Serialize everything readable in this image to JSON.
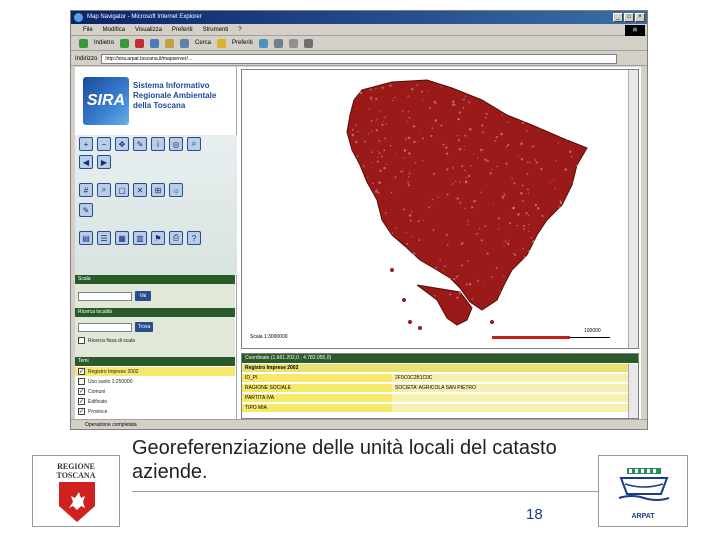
{
  "browser": {
    "title": "Map Navigator - Microsoft Internet Explorer",
    "menu": [
      "File",
      "Modifica",
      "Visualizza",
      "Preferiti",
      "Strumenti",
      "?"
    ],
    "toolbar": {
      "back": "Indietro",
      "search": "Cerca",
      "favorites": "Preferiti"
    },
    "address_label": "Indirizzo",
    "address": "http://sira.arpat.toscana.it/mapserver/...",
    "status": "Operazione completata"
  },
  "sira": {
    "badge": "SIRA",
    "lines": [
      "Sistema Informativo",
      "Regionale Ambientale",
      "della Toscana"
    ]
  },
  "left_panel": {
    "scala_label": "Scala",
    "scala_button": "Vai",
    "ricerca_label": "Ricerca località",
    "ricerca_button": "Trova",
    "scale_checkbox": "Ricerca fissa di scala",
    "temi_label": "Temi",
    "layers": [
      {
        "label": "Registro Imprese 2002",
        "checked": true,
        "highlight": true
      },
      {
        "label": "Uso suolo 1:250000",
        "checked": false,
        "highlight": false
      },
      {
        "label": "Comuni",
        "checked": true,
        "highlight": false
      },
      {
        "label": "Edificato",
        "checked": true,
        "highlight": false
      },
      {
        "label": "Province",
        "checked": true,
        "highlight": false
      }
    ]
  },
  "map": {
    "scale_text": "Scala 1:3000000",
    "scale_bar_label": "100000"
  },
  "info": {
    "header": "Coordinate (1.661.202,0 ; 4.782.055,0)",
    "group": "Registro Imprese 2002",
    "rows": [
      {
        "key": "ID_PI",
        "value": "2F0C0C2B1C0C"
      },
      {
        "key": "RAGIONE SOCIALE",
        "value": "SOCIETA' AGRICOLA SAN PIETRO"
      },
      {
        "key": "PARTITA IVA",
        "value": ""
      },
      {
        "key": "TIPO MIA",
        "value": ""
      }
    ]
  },
  "slide": {
    "caption": "Georeferenziazione delle unità locali del catasto aziende.",
    "page_number": "18",
    "logo_left_lines": [
      "REGIONE",
      "TOSCANA"
    ],
    "logo_right_text": "ARPAT"
  },
  "colors": {
    "map_points": "#9a1a1a",
    "panel_header": "#2a5a2a",
    "highlight": "#f5e86a",
    "titlebar": "#0a246a"
  }
}
